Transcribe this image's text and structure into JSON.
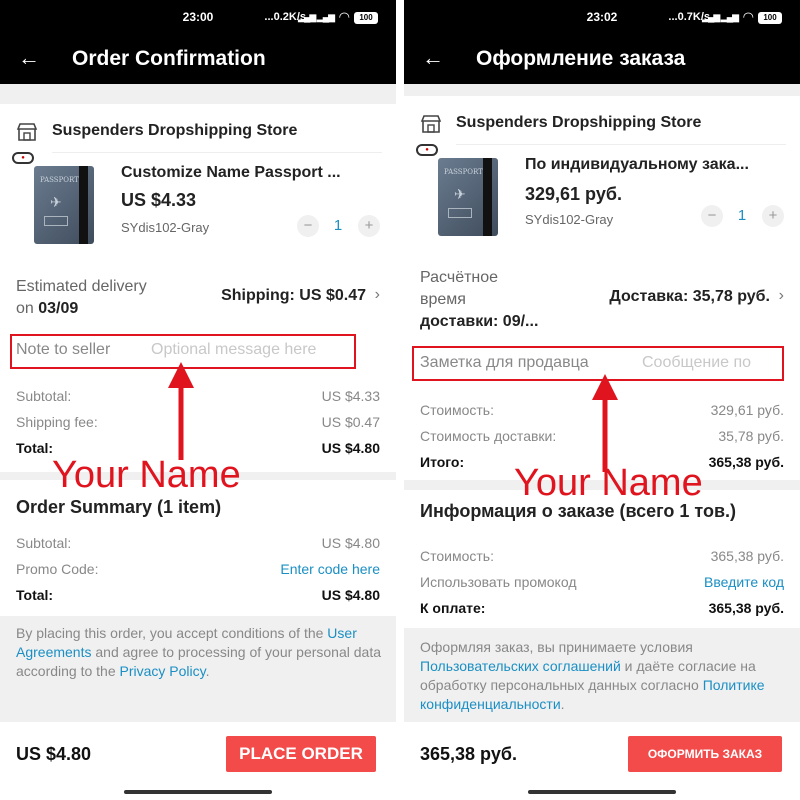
{
  "colors": {
    "accent_red": "#e0141e",
    "button_red": "#f34a4a",
    "link_blue": "#1a8fc4",
    "bar_black": "#000000"
  },
  "left": {
    "status": {
      "time": "23:00",
      "network": "...0.2K/s",
      "battery": "100"
    },
    "title": "Order Confirmation",
    "store_name": "Suspenders Dropshipping Store",
    "product": {
      "name": "Customize Name Passport ...",
      "price": "US $4.33",
      "sku": "SYdis102-Gray",
      "quantity": "1",
      "minus": "−",
      "plus": "+",
      "image_text": "PASSPORT"
    },
    "delivery_label": "Estimated delivery",
    "delivery_on": "on",
    "delivery_date": "03/09",
    "shipping": "Shipping: US $0.47",
    "note_label": "Note to seller",
    "note_placeholder": "Optional message here",
    "annotation": "Your Name",
    "summary1": [
      {
        "label": "Subtotal:",
        "value": "US $4.33"
      },
      {
        "label": "Shipping fee:",
        "value": "US $0.47"
      },
      {
        "label": "Total:",
        "value": "US $4.80"
      }
    ],
    "order_summary_title": "Order Summary (1 item)",
    "summary2": [
      {
        "label": "Subtotal:",
        "value": "US $4.80"
      },
      {
        "label": "Promo Code:",
        "value": "Enter code here"
      },
      {
        "label": "Total:",
        "value": "US $4.80"
      }
    ],
    "legal": {
      "t1": "By placing this order, you accept conditions of the ",
      "l1": "User Agreements",
      "t2": " and agree to processing of your personal data according to the ",
      "l2": "Privacy Policy",
      "t3": "."
    },
    "bottom_total": "US $4.80",
    "place_order": "PLACE ORDER"
  },
  "right": {
    "status": {
      "time": "23:02",
      "network": "...0.7K/s",
      "battery": "100"
    },
    "title": "Оформление заказа",
    "store_name": "Suspenders Dropshipping Store",
    "product": {
      "name": "По индивидуальному зака...",
      "price": "329,61 руб.",
      "sku": "SYdis102-Gray",
      "quantity": "1",
      "minus": "−",
      "plus": "+",
      "image_text": "PASSPORT"
    },
    "delivery_lines": [
      "Расчётное",
      "время",
      "доставки: 09/..."
    ],
    "shipping": "Доставка: 35,78 руб.",
    "note_label": "Заметка для продавца",
    "note_placeholder": "Сообщение по",
    "annotation": "Your Name",
    "summary1": [
      {
        "label": "Стоимость:",
        "value": "329,61 руб."
      },
      {
        "label": "Стоимость доставки:",
        "value": "35,78 руб."
      },
      {
        "label": "Итого:",
        "value": "365,38 руб."
      }
    ],
    "order_summary_title": "Информация о заказе (всего 1 тов.)",
    "summary2": [
      {
        "label": "Стоимость:",
        "value": "365,38 руб."
      },
      {
        "label": "Использовать промокод",
        "value": "Введите код"
      },
      {
        "label": "К оплате:",
        "value": "365,38 руб."
      }
    ],
    "legal": {
      "t1": "Оформляя заказ, вы принимаете условия ",
      "l1": "Пользовательских соглашений",
      "t2": " и даёте согласие на обработку персональных данных согласно ",
      "l2": "Политике конфиденциальности",
      "t3": "."
    },
    "bottom_total": "365,38 руб.",
    "place_order": "ОФОРМИТЬ ЗАКАЗ"
  }
}
